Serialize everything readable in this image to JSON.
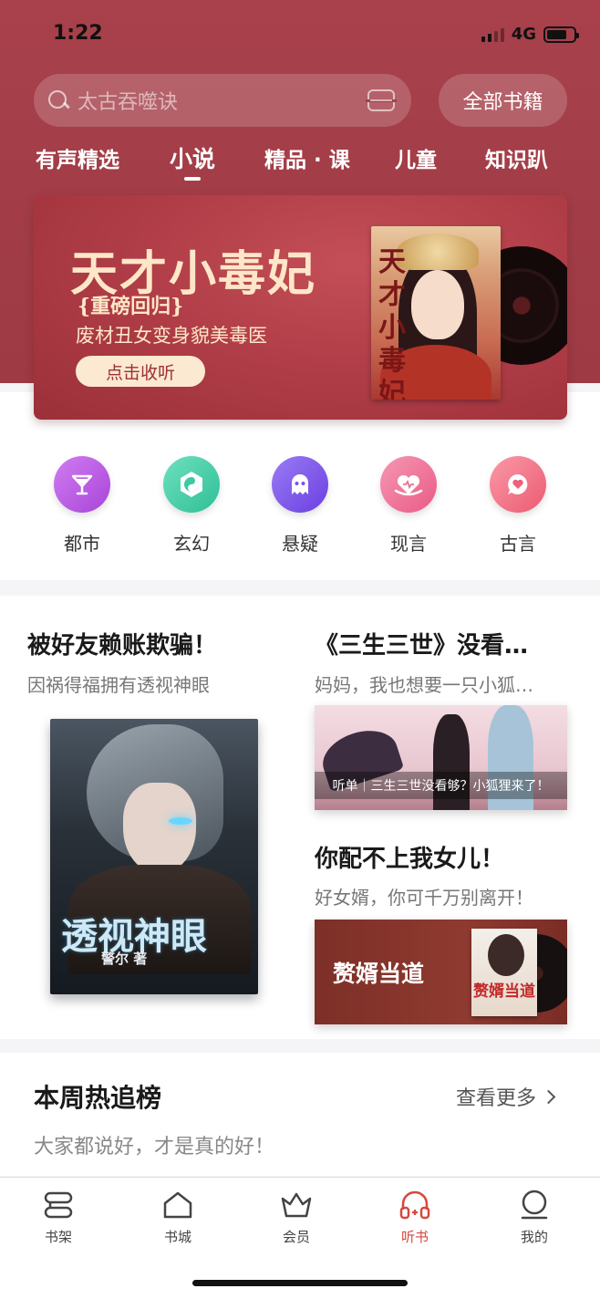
{
  "status": {
    "time": "1:22",
    "network": "4G",
    "battery_level": 0.74
  },
  "search": {
    "placeholder": "太古吞噬诀"
  },
  "header": {
    "all_books": "全部书籍"
  },
  "tabs": [
    {
      "label": "有声精选"
    },
    {
      "label": "小说",
      "active": true
    },
    {
      "label": "精品 · 课"
    },
    {
      "label": "儿童"
    },
    {
      "label": "知识趴"
    }
  ],
  "banner": {
    "title": "天才小毒妃",
    "subtitle": "{重磅回归}",
    "description": "废材丑女变身貌美毒医",
    "button": "点击收听",
    "cover_title": "天才小毒妃"
  },
  "categories": [
    {
      "label": "都市",
      "icon": "cocktail-icon",
      "color": "#b955e0"
    },
    {
      "label": "玄幻",
      "icon": "yin-yang-icon",
      "color": "#3dc9a3"
    },
    {
      "label": "悬疑",
      "icon": "ghost-icon",
      "color": "#7b52e8"
    },
    {
      "label": "现言",
      "icon": "heart-icon",
      "color": "#ef6e95"
    },
    {
      "label": "古言",
      "icon": "heart-bubble-icon",
      "color": "#f0607a"
    }
  ],
  "recommend": {
    "left": {
      "title": "被好友赖账欺骗！",
      "subtitle": "因祸得福拥有透视神眼",
      "cover_title": "透视神眼",
      "cover_author": "警尔 著"
    },
    "right_top": {
      "title": "《三生三世》没看…",
      "subtitle": "妈妈，我也想要一只小狐…",
      "caption": "听单｜三生三世没看够？小狐狸来了！"
    },
    "right_bottom": {
      "title": "你配不上我女儿！",
      "subtitle": "好女婿，你可千万别离开！",
      "image_text": "赘婿当道",
      "cover_title": "赘婿当道"
    }
  },
  "hot": {
    "title": "本周热追榜",
    "more": "查看更多",
    "subtitle": "大家都说好，才是真的好！"
  },
  "tabbar": [
    {
      "label": "书架",
      "icon": "bookshelf-icon"
    },
    {
      "label": "书城",
      "icon": "home-icon"
    },
    {
      "label": "会员",
      "icon": "crown-icon"
    },
    {
      "label": "听书",
      "icon": "headphones-icon",
      "active": true
    },
    {
      "label": "我的",
      "icon": "profile-icon"
    }
  ],
  "colors": {
    "brand": "#a8414b",
    "accent": "#d8473e"
  }
}
